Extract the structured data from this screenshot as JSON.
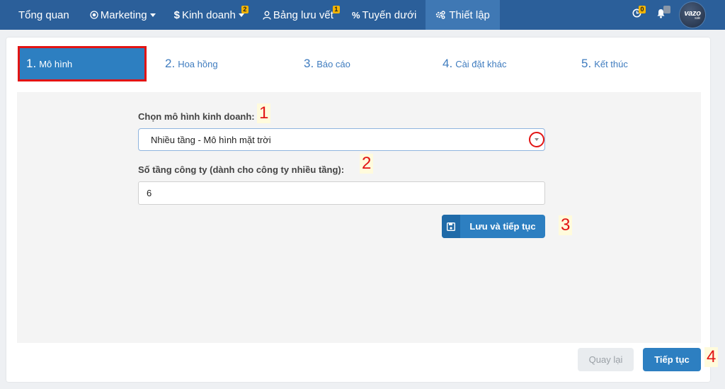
{
  "topnav": {
    "items": [
      {
        "label": "Tổng quan",
        "icon": ""
      },
      {
        "label": "Marketing",
        "icon": "target-icon"
      },
      {
        "label": "Kinh doanh",
        "icon": "dollar-icon",
        "badge": "2"
      },
      {
        "label": "Bảng lưu vết",
        "icon": "user-icon",
        "badge": "1"
      },
      {
        "label": "Tuyến dưới",
        "icon": "percent-icon"
      },
      {
        "label": "Thiết lập",
        "icon": "gears-icon"
      }
    ],
    "timer_badge": "0",
    "bell_badge": "",
    "avatar_text": "vazo",
    "avatar_sub": "sale"
  },
  "steps": [
    {
      "num": "1.",
      "label": "Mô hình"
    },
    {
      "num": "2.",
      "label": "Hoa hồng"
    },
    {
      "num": "3.",
      "label": "Báo cáo"
    },
    {
      "num": "4.",
      "label": "Cài đặt khác"
    },
    {
      "num": "5.",
      "label": "Kết thúc"
    }
  ],
  "form": {
    "model_label": "Chọn mô hình kinh doanh:",
    "model_value": "Nhiều tầng - Mô hình mặt trời",
    "levels_label": "Số tầng công ty (dành cho công ty nhiều tầng):",
    "levels_value": "6",
    "save_button": "Lưu và tiếp tục"
  },
  "annotations": [
    "1",
    "2",
    "3",
    "4"
  ],
  "footer": {
    "back_button": "Quay lại",
    "next_button": "Tiếp tục"
  },
  "colors": {
    "nav_bg": "#2b5f9a",
    "primary": "#2d7fc1",
    "annotation_red": "#e21414"
  }
}
